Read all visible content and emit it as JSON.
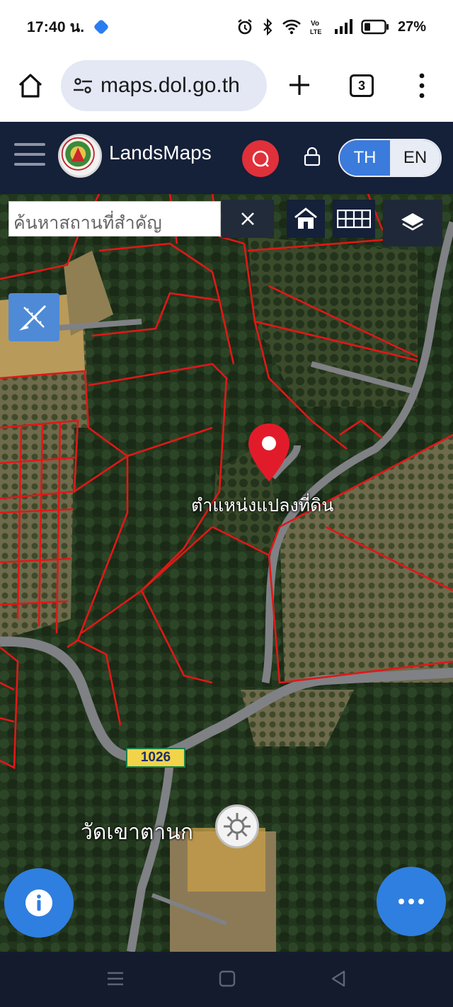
{
  "status_bar": {
    "time": "17:40 น.",
    "battery_percent": "27%",
    "icons": [
      "alarm-icon",
      "bluetooth-icon",
      "wifi-icon",
      "volte-icon",
      "signal-icon",
      "battery-icon"
    ]
  },
  "browser": {
    "url": "maps.dol.go.th",
    "tab_count": "3"
  },
  "app_header": {
    "brand": "LandsMaps",
    "lang_th": "TH",
    "lang_en": "EN",
    "active_lang": "TH",
    "colors": {
      "header_bg": "#152039",
      "search_red": "#e0303a",
      "lang_active": "#3b7bdc"
    }
  },
  "map": {
    "search_placeholder": "ค้นหาสถานที่สำคัญ",
    "clear_label": "×",
    "pin_label": "ตำแหน่งแปลงที่ดิน",
    "road_number": "1026",
    "temple_name": "วัดเขาตานก",
    "parcel_color": "#e01818",
    "fab_color": "#2f7fe0"
  }
}
